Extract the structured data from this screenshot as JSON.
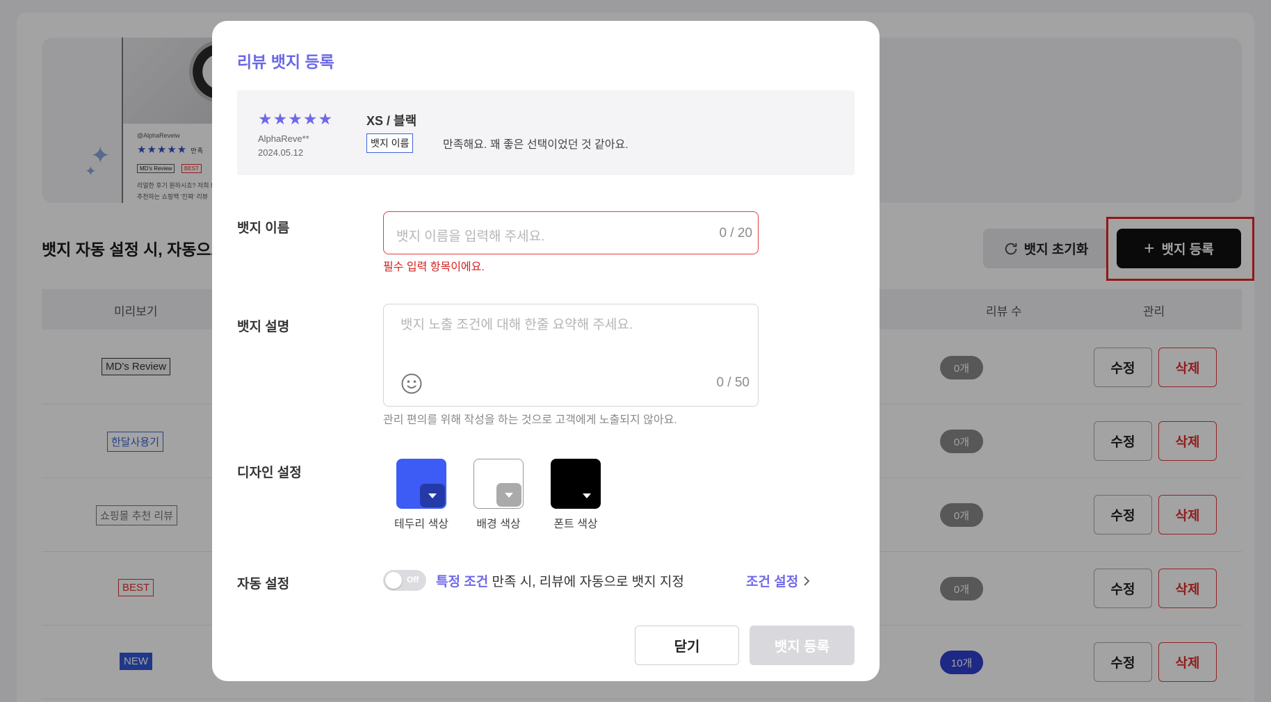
{
  "page": {
    "section_title": "뱃지 자동 설정 시, 자동으로",
    "reset_label": "뱃지 초기화",
    "register_label": "뱃지 등록",
    "table": {
      "headers": {
        "preview": "미리보기",
        "review_count": "리뷰 수",
        "manage": "관리"
      },
      "rows": [
        {
          "badge": "MD's Review",
          "count": "0개",
          "edit": "수정",
          "delete": "삭제"
        },
        {
          "badge": "한달사용기",
          "count": "0개",
          "edit": "수정",
          "delete": "삭제"
        },
        {
          "badge": "쇼핑몰 추천 리뷰",
          "count": "0개",
          "edit": "수정",
          "delete": "삭제"
        },
        {
          "badge": "BEST",
          "count": "0개",
          "edit": "수정",
          "delete": "삭제"
        },
        {
          "badge": "NEW",
          "count": "10개",
          "edit": "수정",
          "delete": "삭제"
        }
      ]
    },
    "banner": {
      "handle": "@AlphaReveiw",
      "badge1": "MD's Review",
      "badge2": "BEST",
      "line1": "리얼한 후기 원하시죠? 저희 M",
      "line2": "추천하는 쇼핑백 '진짜' 리뷰",
      "star_suffix": "만족"
    }
  },
  "modal": {
    "title": "리뷰 뱃지 등록",
    "preview": {
      "stars": "★★★★★",
      "user": "AlphaReve**",
      "date": "2024.05.12",
      "option": "XS / 블랙",
      "badge": "뱃지 이름",
      "text": "만족해요. 꽤 좋은 선택이었던 것 같아요."
    },
    "name_field": {
      "label": "뱃지 이름",
      "placeholder": "뱃지 이름을 입력해 주세요.",
      "counter": "0 / 20",
      "error": "필수 입력 항목이에요."
    },
    "desc_field": {
      "label": "뱃지 설명",
      "placeholder": "뱃지 노출 조건에 대해 한줄 요약해 주세요.",
      "counter": "0 / 50",
      "help": "관리 편의를 위해 작성을 하는 것으로 고객에게 노출되지 않아요."
    },
    "design": {
      "label": "디자인 설정",
      "border_label": "테두리 색상",
      "bg_label": "배경 색상",
      "font_label": "폰트 색상",
      "border_color": "#3d5cf5",
      "bg_color": "#ffffff",
      "font_color": "#000000"
    },
    "auto": {
      "label": "자동 설정",
      "toggle": "Off",
      "highlight": "특정 조건",
      "text": " 만족 시, 리뷰에 자동으로 뱃지 지정",
      "condition_link": "조건 설정"
    },
    "close_label": "닫기",
    "submit_label": "뱃지 등록"
  },
  "colors": {
    "accent": "#6f68e8",
    "error": "#d42020",
    "primary_dark": "#111111"
  }
}
